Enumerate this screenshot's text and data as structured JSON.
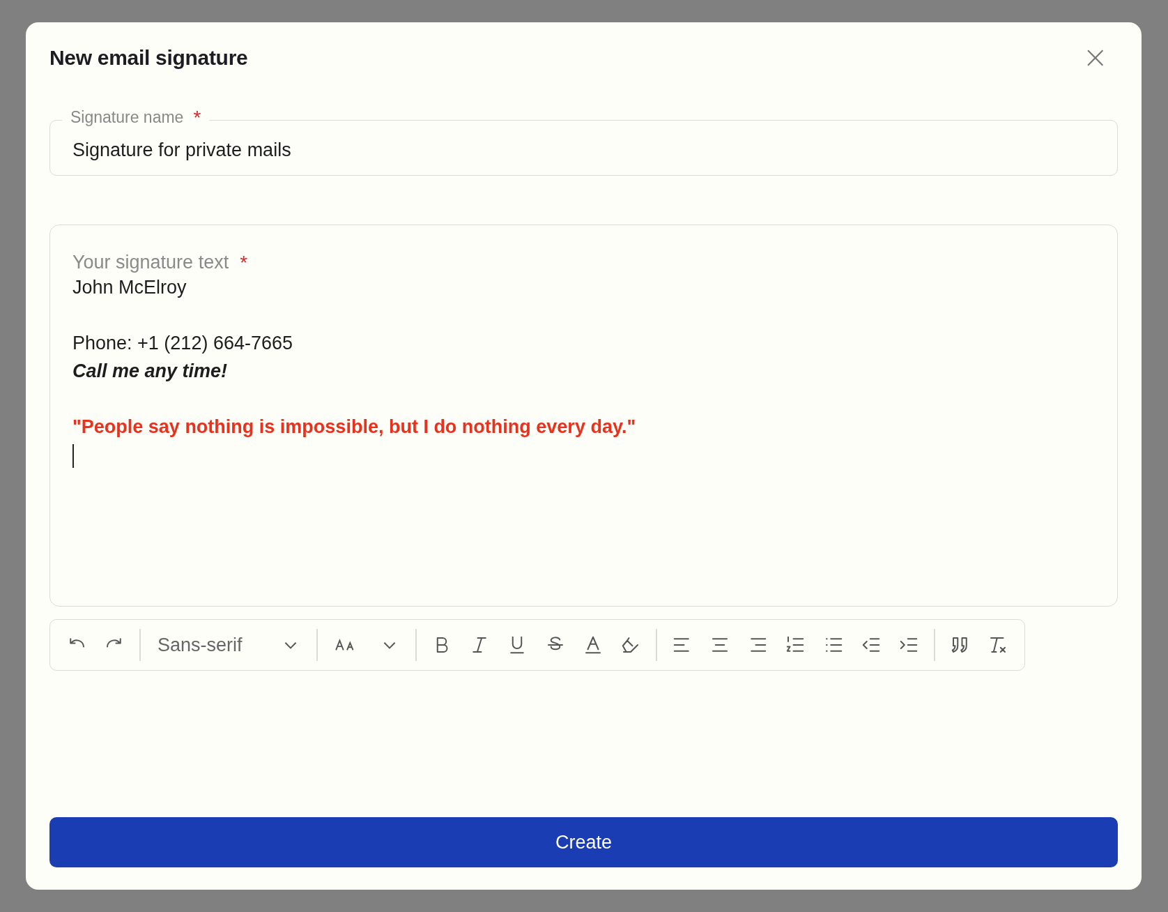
{
  "dialog": {
    "title": "New email signature",
    "close": "×"
  },
  "name_field": {
    "label": "Signature name",
    "required_mark": "*",
    "value": "Signature for private mails"
  },
  "editor": {
    "label": "Your signature text",
    "required_mark": "*",
    "lines": [
      {
        "kind": "text",
        "text": "John McElroy"
      },
      {
        "kind": "spacer"
      },
      {
        "kind": "text",
        "text": "Phone: +1 (212) 664-7665"
      },
      {
        "kind": "emphasis",
        "text": "Call me any time!"
      },
      {
        "kind": "spacer"
      },
      {
        "kind": "highlight",
        "text": "\"People say nothing is impossible, but I do nothing every day.\""
      },
      {
        "kind": "caret"
      }
    ]
  },
  "toolbar": [
    {
      "kind": "icon"
    },
    {
      "kind": "icon"
    },
    {
      "kind": "divider"
    },
    {
      "kind": "select",
      "label": "Sans-serif"
    },
    {
      "kind": "divider"
    },
    {
      "kind": "size-select"
    },
    {
      "kind": "divider"
    },
    {
      "kind": "icon"
    },
    {
      "kind": "icon"
    },
    {
      "kind": "icon"
    },
    {
      "kind": "icon"
    },
    {
      "kind": "icon"
    },
    {
      "kind": "icon"
    },
    {
      "kind": "divider"
    },
    {
      "kind": "icon"
    },
    {
      "kind": "icon"
    },
    {
      "kind": "icon"
    },
    {
      "kind": "icon"
    },
    {
      "kind": "icon"
    },
    {
      "kind": "icon"
    },
    {
      "kind": "icon"
    },
    {
      "kind": "divider"
    },
    {
      "kind": "icon"
    },
    {
      "kind": "icon"
    }
  ],
  "submit": {
    "label": "Create"
  }
}
